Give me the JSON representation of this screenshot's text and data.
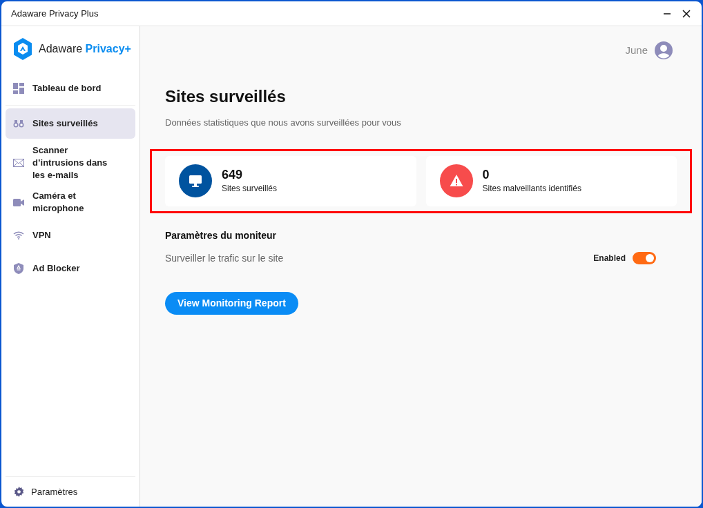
{
  "window": {
    "title": "Adaware Privacy Plus"
  },
  "logo": {
    "name": "Adaware",
    "product": "Privacy+"
  },
  "sidebar": {
    "items": [
      {
        "label": "Tableau de bord",
        "selected": false
      },
      {
        "label": "Sites surveillés",
        "selected": true
      },
      {
        "label": "Scanner d’intrusions dans les e-mails",
        "selected": false
      },
      {
        "label": "Caméra et microphone",
        "selected": false
      },
      {
        "label": "VPN",
        "selected": false
      },
      {
        "label": "Ad Blocker",
        "selected": false
      }
    ],
    "footer": {
      "label": "Paramètres"
    }
  },
  "user": {
    "name": "June"
  },
  "page": {
    "title": "Sites surveillés",
    "subtitle": "Données statistiques que nous avons surveillées pour vous"
  },
  "stats": [
    {
      "kind": "monitor",
      "value": "649",
      "label": "Sites surveillés"
    },
    {
      "kind": "alert",
      "value": "0",
      "label": "Sites malveillants identifiés"
    }
  ],
  "monitor_settings": {
    "heading": "Paramètres du moniteur",
    "row": {
      "label": "Surveiller le trafic sur le site",
      "state_label": "Enabled",
      "on": true
    }
  },
  "report_button": {
    "label": "View Monitoring Report"
  }
}
